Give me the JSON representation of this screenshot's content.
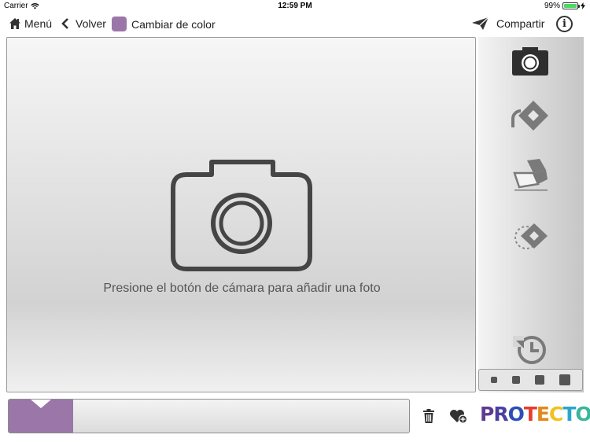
{
  "status_bar": {
    "carrier": "Carrier",
    "time": "12:59 PM",
    "battery": "99%",
    "battery_level": 0.99
  },
  "toolbar": {
    "menu_label": "Menú",
    "back_label": "Volver",
    "color_label": "Cambiar de color",
    "share_label": "Compartir",
    "info_label": "i",
    "current_color": "#9b76a8"
  },
  "canvas": {
    "hint": "Presione el botón de cámara para añadir una foto"
  },
  "sidebar": {
    "tools": [
      "camera-icon",
      "rotate-left-icon",
      "eraser-icon",
      "rotate-outline-icon",
      "history-icon"
    ],
    "brush_sizes": 4
  },
  "bottom": {
    "slider_level": 0.16,
    "fill_color": "#9b76a8"
  },
  "logo": {
    "letters": [
      "P",
      "R",
      "O",
      "T",
      "E",
      "C",
      "T",
      "O"
    ],
    "colors": [
      "#5e3b8e",
      "#4d3fa0",
      "#2d4fb3",
      "#e63d2e",
      "#e08a1e",
      "#f1c21b",
      "#2aa6c8",
      "#3bb59c"
    ]
  }
}
